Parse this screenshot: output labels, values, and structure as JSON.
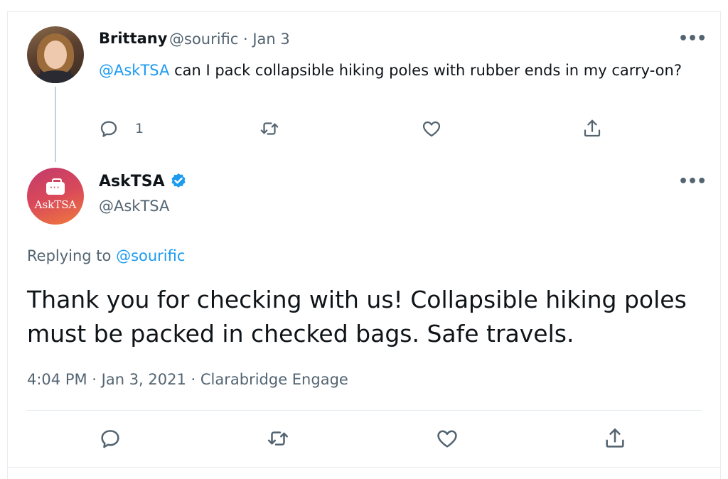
{
  "parent_tweet": {
    "author_name": "Brittany",
    "meta": "@sourific · Jan 3",
    "more": "•••",
    "text_mention": "@AskTSA",
    "text_body": " can I pack collapsible hiking poles with rubber ends in my carry-on?",
    "actions": {
      "reply_count": "1",
      "retweet_count": "",
      "like_count": ""
    }
  },
  "reply_tweet": {
    "author_name": "AskTSA",
    "handle": "@AskTSA",
    "avatar_text": "AskTSA",
    "more": "•••",
    "replying_prefix": "Replying to ",
    "replying_mention": "@sourific",
    "text": "Thank you for checking with us! Collapsible hiking poles must be packed in checked bags. Safe travels.",
    "timestamp": "4:04 PM · Jan 3, 2021 · Clarabridge Engage"
  },
  "colors": {
    "accent": "#1d9bf0",
    "secondary_text": "#536471",
    "primary_text": "#0f1419",
    "verified_badge": "#1d9bf0"
  },
  "icons": [
    "reply-icon",
    "retweet-icon",
    "like-icon",
    "share-icon",
    "verified-badge-icon",
    "more-icon"
  ]
}
